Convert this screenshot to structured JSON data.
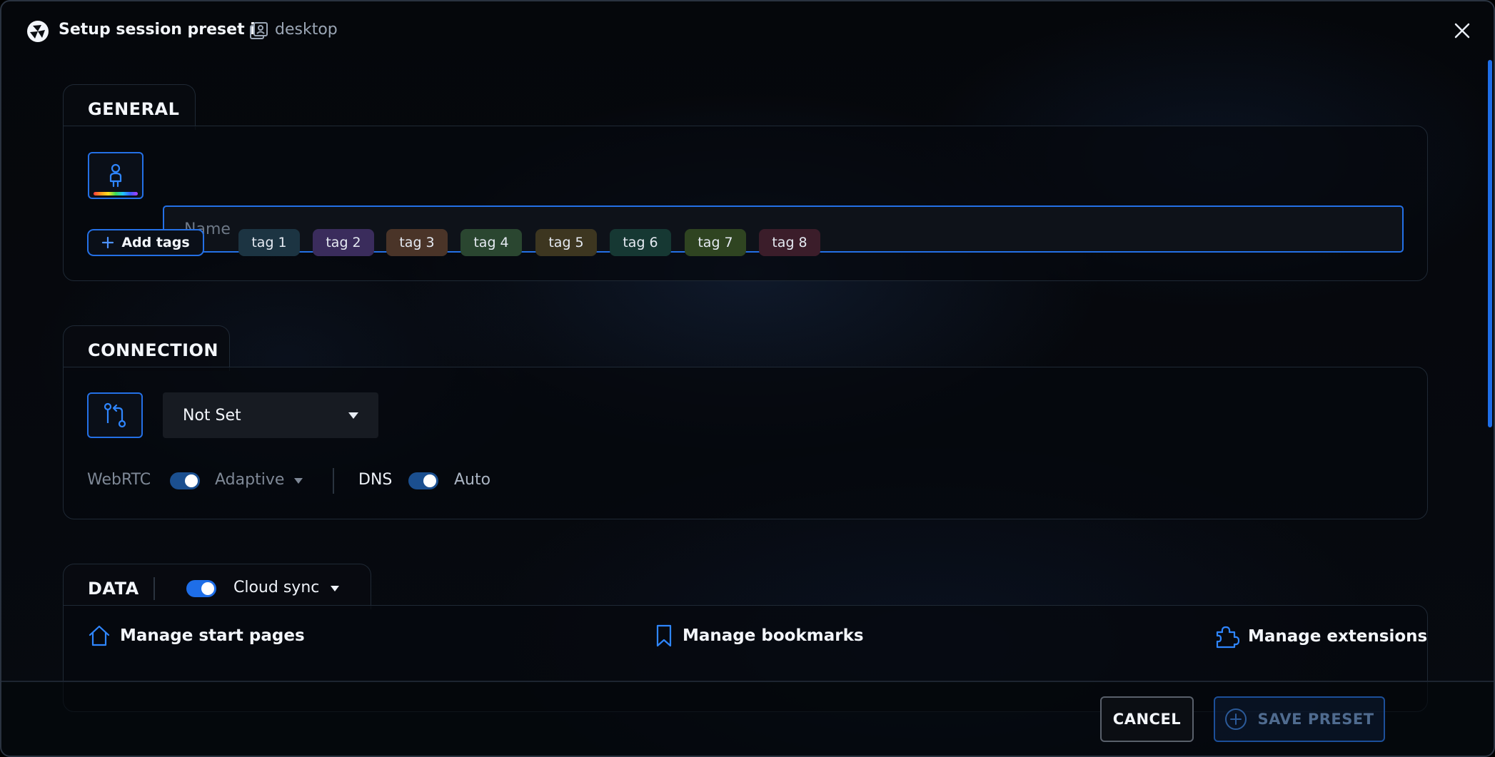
{
  "header": {
    "title": "Setup session preset in",
    "workspace": "desktop"
  },
  "general": {
    "title": "GENERAL",
    "name_placeholder": "Name",
    "name_value": "",
    "add_tags_label": "Add tags",
    "tags": [
      {
        "label": "tag 1",
        "color": "#1c3442"
      },
      {
        "label": "tag 2",
        "color": "#3a2c5c"
      },
      {
        "label": "tag 3",
        "color": "#4a3428"
      },
      {
        "label": "tag 4",
        "color": "#2a4630"
      },
      {
        "label": "tag 5",
        "color": "#3d3620"
      },
      {
        "label": "tag 6",
        "color": "#163833"
      },
      {
        "label": "tag 7",
        "color": "#2f4421"
      },
      {
        "label": "tag 8",
        "color": "#3b1d2a"
      }
    ]
  },
  "connection": {
    "title": "CONNECTION",
    "proxy_value": "Not Set",
    "webrtc_label": "WebRTC",
    "webrtc_mode": "Adaptive",
    "dns_label": "DNS",
    "dns_mode": "Auto"
  },
  "data": {
    "title": "DATA",
    "sync_label": "Cloud sync",
    "start_pages_label": "Manage start pages",
    "bookmarks_label": "Manage bookmarks",
    "extensions_label": "Manage extensions"
  },
  "footer": {
    "cancel_label": "CANCEL",
    "save_label": "SAVE PRESET"
  },
  "colors": {
    "accent": "#2470e6",
    "toggle_on": "#1e6ee8",
    "toggle_dim": "#1b4f8f"
  }
}
